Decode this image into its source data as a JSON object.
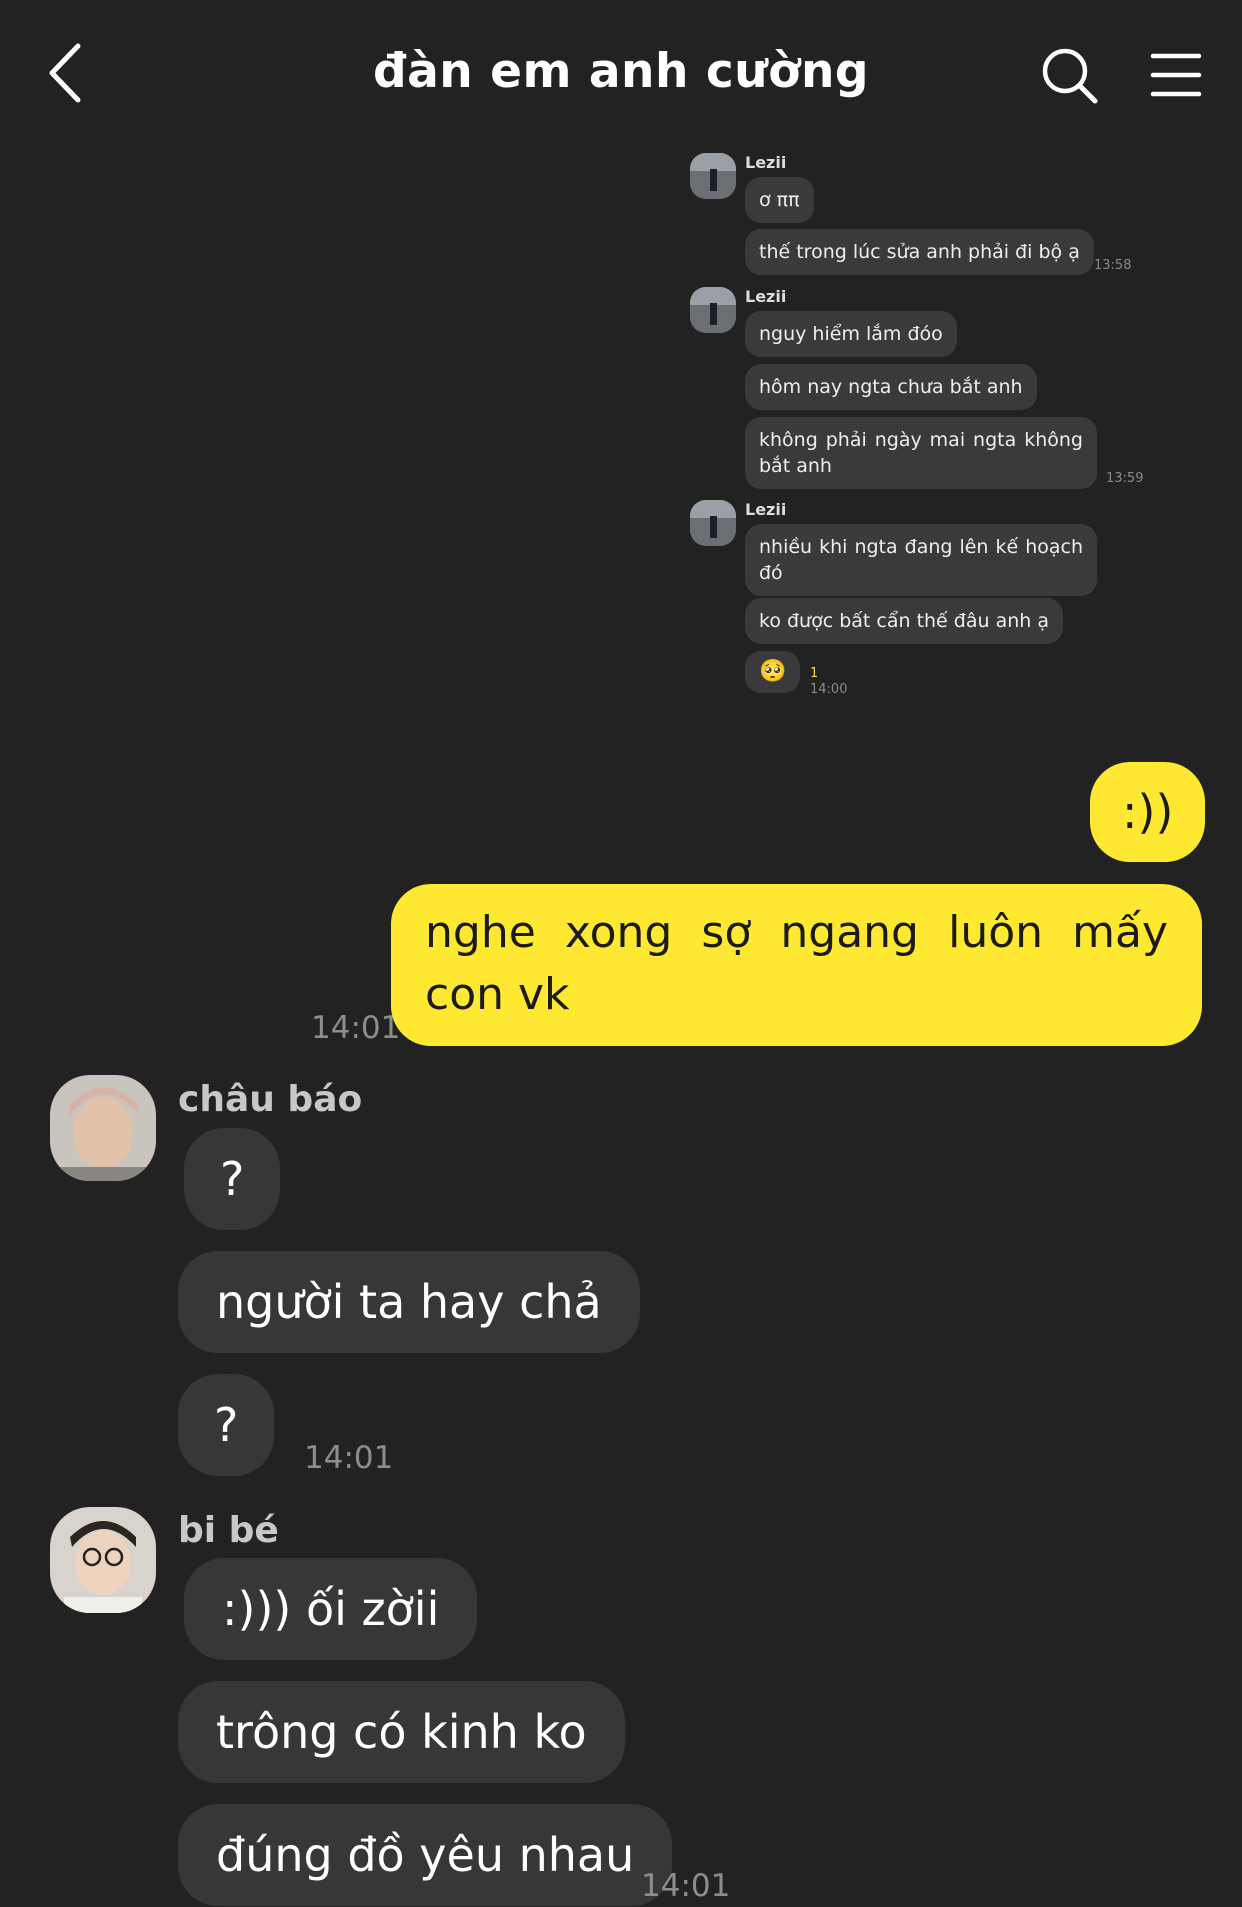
{
  "header": {
    "title": "đàn em anh cường"
  },
  "shared_screenshot": {
    "groups": [
      {
        "sender": "Lezii",
        "messages": [
          "ơ ππ",
          "thế trong lúc sửa anh phải đi bộ ạ"
        ],
        "time": "13:58"
      },
      {
        "sender": "Lezii",
        "messages": [
          "nguy hiểm lắm đóo",
          "hôm nay ngta chưa bắt anh",
          "không phải ngày mai ngta không bắt anh"
        ],
        "time": "13:59"
      },
      {
        "sender": "Lezii",
        "messages": [
          "nhiều khi ngta đang lên kế hoạch đó",
          "ko được bất cẩn thế đâu anh ạ"
        ],
        "time": "14:00"
      }
    ],
    "emoji": "🥺",
    "unread_count": "1"
  },
  "outgoing": {
    "messages": [
      ":))",
      "nghe xong sợ ngang luôn mấy con vk"
    ],
    "time": "14:01"
  },
  "incoming": [
    {
      "sender": "châu báo",
      "messages": [
        "?",
        "người ta hay chả",
        "?"
      ],
      "time": "14:01"
    },
    {
      "sender": "bi bé",
      "messages": [
        ":))) ối zờii",
        "trông có kinh ko",
        "đúng đồ yêu nhau"
      ],
      "time": "14:01"
    }
  ]
}
